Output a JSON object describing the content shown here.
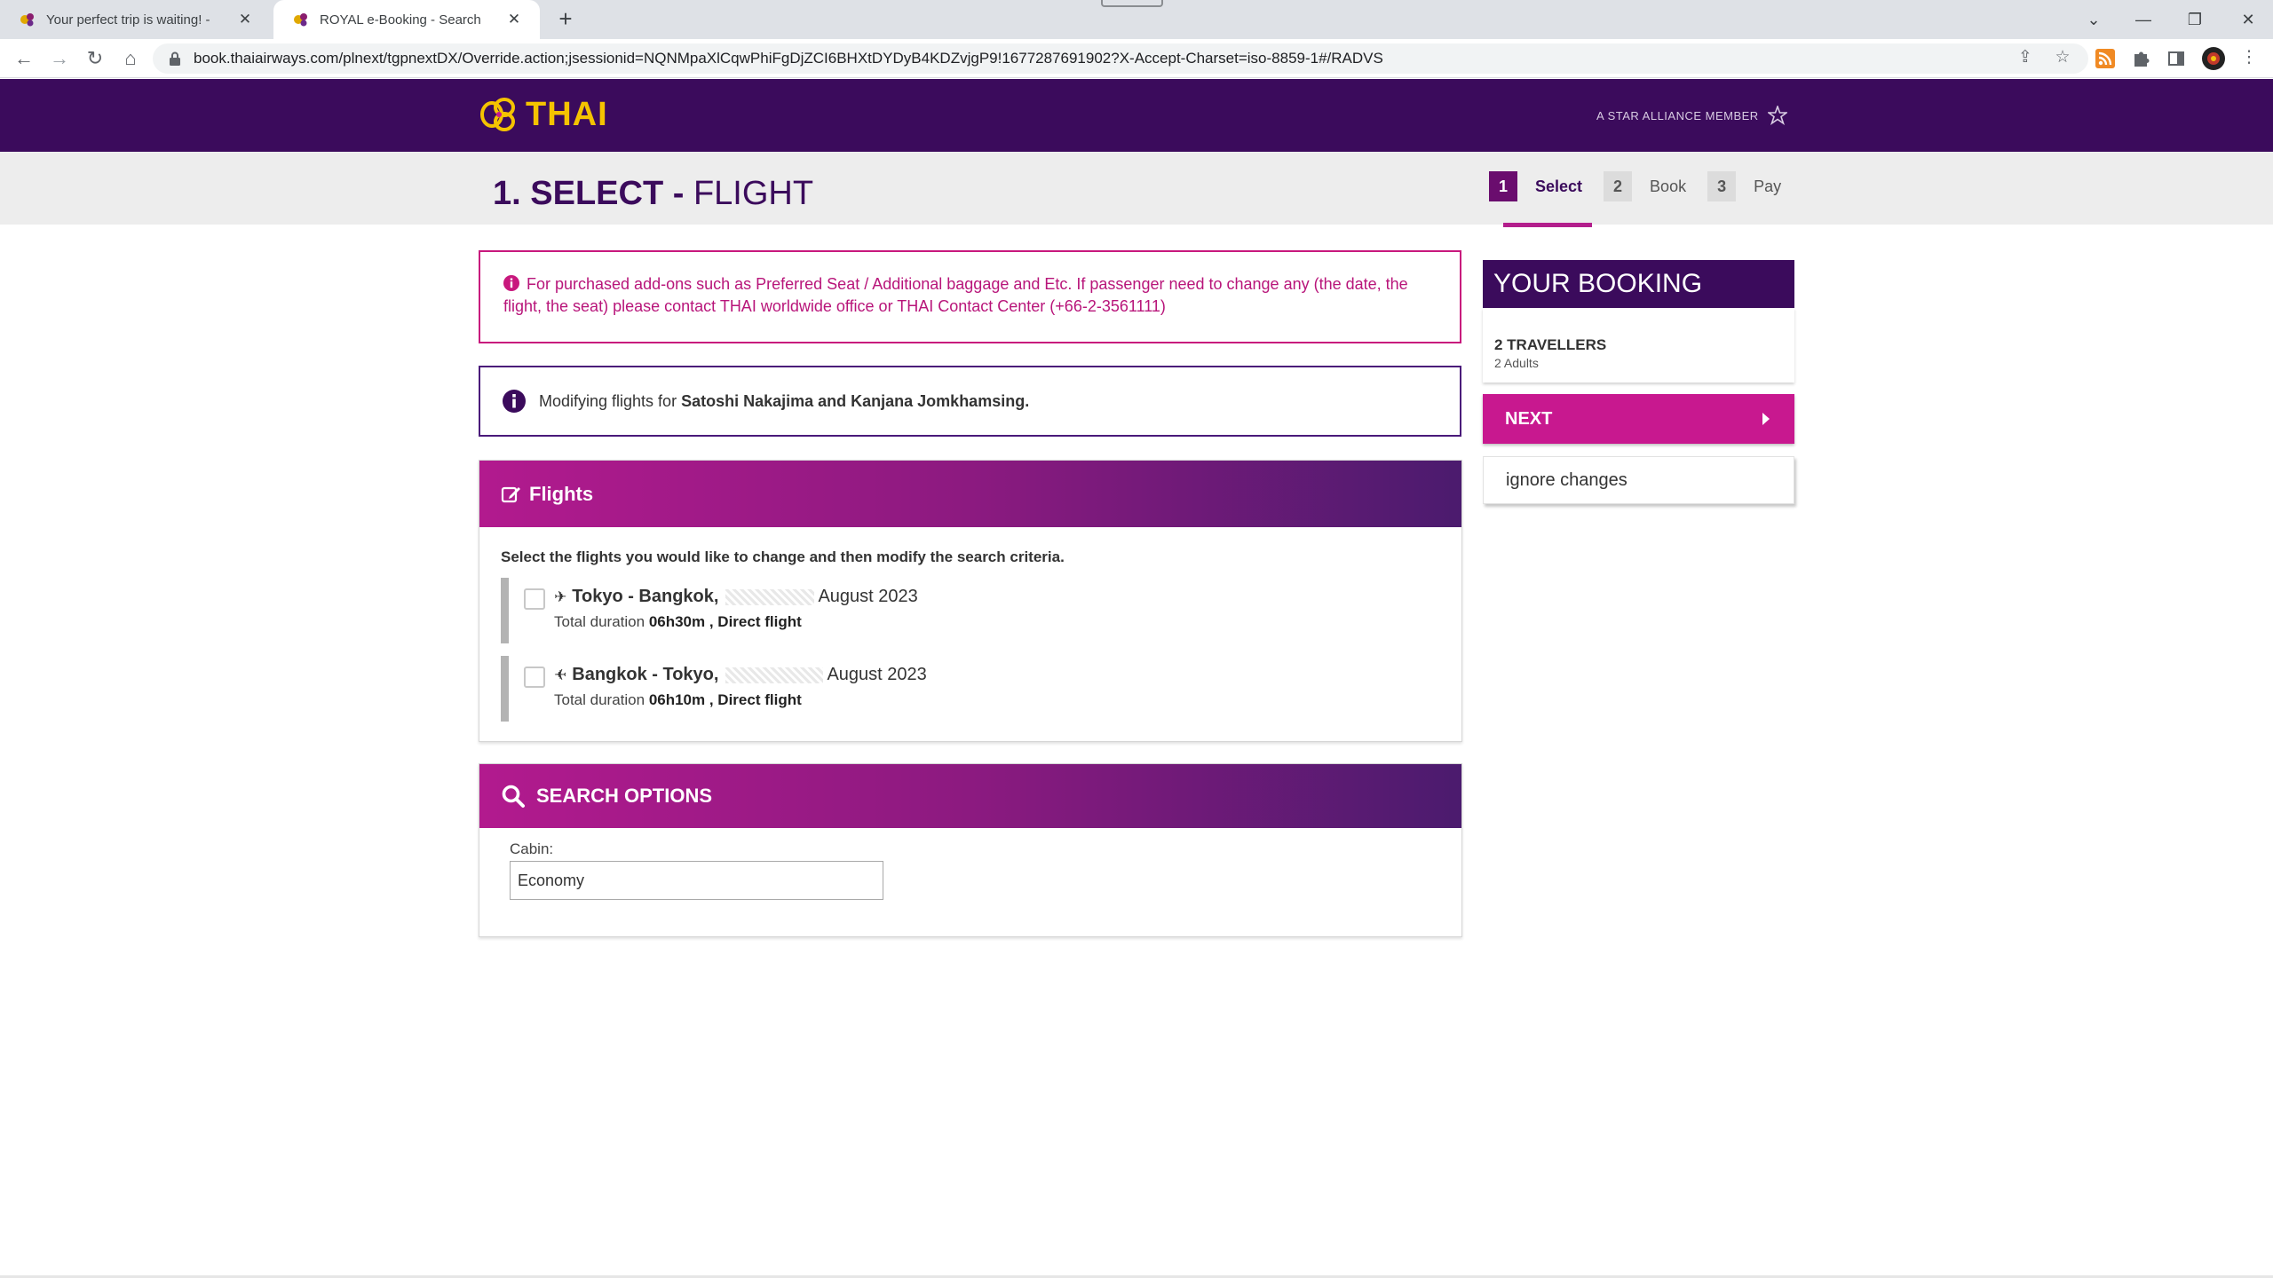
{
  "browser": {
    "tabs": [
      {
        "title": "Your perfect trip is waiting! -",
        "active": false
      },
      {
        "title": "ROYAL e-Booking - Search",
        "active": true
      }
    ],
    "url": "book.thaiairways.com/plnext/tgpnextDX/Override.action;jsessionid=NQNMpaXlCqwPhiFgDjZCI6BHXtDYDyB4KDZvjgP9!1677287691902?X-Accept-Charset=iso-8859-1#/RADVS"
  },
  "site": {
    "logo_text": "THAI",
    "alliance_text": "A STAR ALLIANCE MEMBER"
  },
  "title": {
    "number": "1.",
    "strong": "SELECT -",
    "light": "FLIGHT"
  },
  "steps": [
    {
      "num": "1",
      "label": "Select",
      "active": true
    },
    {
      "num": "2",
      "label": "Book",
      "active": false
    },
    {
      "num": "3",
      "label": "Pay",
      "active": false
    }
  ],
  "alerts": {
    "addons": "For purchased add-ons such as Preferred Seat / Additional baggage and Etc. If passenger need to change any (the date, the flight, the seat) please contact THAI worldwide office or THAI Contact Center (+66-2-3561111)",
    "modifying_prefix": "Modifying flights for",
    "modifying_names": "Satoshi Nakajima and Kanjana Jomkhamsing."
  },
  "flights": {
    "heading": "Flights",
    "instructions": "Select the flights you would like to change and then modify the search criteria.",
    "items": [
      {
        "route": "Tokyo - Bangkok,",
        "date_suffix": "August 2023",
        "duration_label": "Total duration",
        "duration": "06h30m , Direct flight"
      },
      {
        "route": "Bangkok - Tokyo,",
        "date_suffix": "August 2023",
        "duration_label": "Total duration",
        "duration": "06h10m , Direct flight"
      }
    ]
  },
  "search_options": {
    "heading": "SEARCH OPTIONS",
    "cabin_label": "Cabin:",
    "cabin_value": "Economy"
  },
  "booking": {
    "heading": "YOUR BOOKING",
    "travellers": "2 TRAVELLERS",
    "adults": "2 Adults",
    "next_label": "NEXT",
    "ignore_label": "ignore changes"
  },
  "colors": {
    "brand_purple": "#3b0b5c",
    "brand_magenta": "#c8188f",
    "logo_gold": "#f5c300",
    "alert_pink": "#b8157a"
  }
}
